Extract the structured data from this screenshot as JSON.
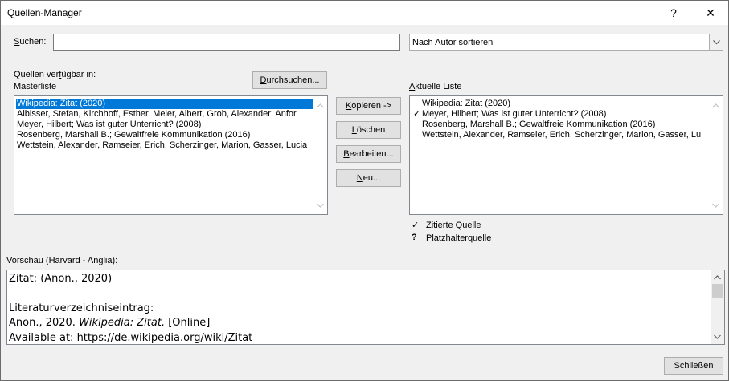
{
  "window": {
    "title": "Quellen-Manager",
    "help_glyph": "?",
    "close_glyph": "✕"
  },
  "search": {
    "label": "Suchen:",
    "value": "",
    "sort_value": "Nach Autor sortieren"
  },
  "master": {
    "available_label": "Quellen verfügbar in:",
    "list_label": "Masterliste",
    "browse_button": "Durchsuchen...",
    "items": [
      "Wikipedia: Zitat (2020)",
      "Albisser, Stefan, Kirchhoff, Esther, Meier, Albert, Grob, Alexander; Anfor",
      "Meyer, Hilbert; Was ist guter Unterricht? (2008)",
      "Rosenberg, Marshall B.; Gewaltfreie Kommunikation (2016)",
      "Wettstein, Alexander, Ramseier, Erich, Scherzinger, Marion, Gasser, Lucia"
    ],
    "selected_index": 0
  },
  "actions": {
    "copy": "Kopieren ->",
    "delete": "Löschen",
    "edit": "Bearbeiten...",
    "new": "Neu..."
  },
  "current": {
    "list_label": "Aktuelle Liste",
    "items": [
      {
        "mark": "",
        "text": "Wikipedia: Zitat (2020)"
      },
      {
        "mark": "✓",
        "text": "Meyer, Hilbert; Was ist guter Unterricht? (2008)"
      },
      {
        "mark": "",
        "text": "Rosenberg, Marshall B.; Gewaltfreie Kommunikation (2016)"
      },
      {
        "mark": "",
        "text": "Wettstein, Alexander, Ramseier, Erich, Scherzinger, Marion, Gasser, Lu"
      }
    ]
  },
  "legend": {
    "cited_mark": "✓",
    "cited_label": "Zitierte Quelle",
    "placeholder_mark": "?",
    "placeholder_label": "Platzhalterquelle"
  },
  "preview": {
    "label": "Vorschau (Harvard - Anglia):",
    "line1": "Zitat:  (Anon., 2020)",
    "line2": "Literaturverzeichniseintrag:",
    "line3_prefix": "Anon., 2020. ",
    "line3_italic": "Wikipedia: Zitat.",
    "line3_suffix": " [Online]",
    "line4_prefix": "Available at: ",
    "line4_link": "https://de.wikipedia.org/wiki/Zitat"
  },
  "footer": {
    "close_button": "Schließen"
  }
}
